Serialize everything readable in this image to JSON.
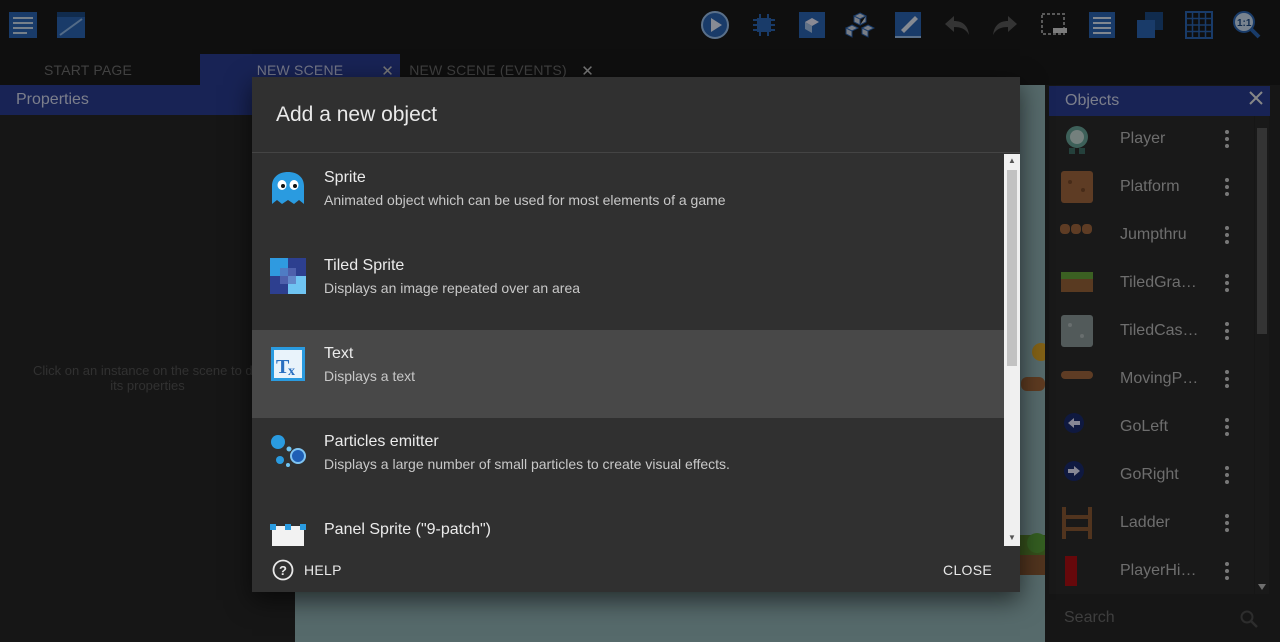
{
  "tabs": [
    {
      "label": "START PAGE"
    },
    {
      "label": "NEW SCENE"
    },
    {
      "label": "NEW SCENE (EVENTS)"
    }
  ],
  "properties": {
    "title": "Properties",
    "hint_line1": "Click on an instance on the scene to dis",
    "hint_line2": "its properties"
  },
  "objects_panel": {
    "title": "Objects",
    "items": [
      {
        "name": "Player",
        "icon": "player-icon"
      },
      {
        "name": "Platform",
        "icon": "platform-icon"
      },
      {
        "name": "Jumpthru",
        "icon": "jumpthru-icon"
      },
      {
        "name": "TiledGra…",
        "icon": "tiled-grass-icon"
      },
      {
        "name": "TiledCas…",
        "icon": "tiled-castle-icon"
      },
      {
        "name": "MovingP…",
        "icon": "moving-platform-icon"
      },
      {
        "name": "GoLeft",
        "icon": "go-left-icon"
      },
      {
        "name": "GoRight",
        "icon": "go-right-icon"
      },
      {
        "name": "Ladder",
        "icon": "ladder-icon"
      },
      {
        "name": "PlayerHi…",
        "icon": "player-hitbox-icon"
      }
    ],
    "search_placeholder": "Search"
  },
  "dialog": {
    "title": "Add a new object",
    "items": [
      {
        "name": "Sprite",
        "description": "Animated object which can be used for most elements of a game",
        "icon": "sprite-ghost-icon"
      },
      {
        "name": "Tiled Sprite",
        "description": "Displays an image repeated over an area",
        "icon": "tiled-sprite-icon"
      },
      {
        "name": "Text",
        "description": "Displays a text",
        "icon": "text-object-icon"
      },
      {
        "name": "Particles emitter",
        "description": "Displays a large number of small particles to create visual effects.",
        "icon": "particles-icon"
      },
      {
        "name": "Panel Sprite (\"9-patch\")",
        "description": "",
        "icon": "panel-sprite-icon"
      }
    ],
    "help_label": "HELP",
    "close_label": "CLOSE"
  },
  "colors": {
    "accent": "#2a3d93",
    "panel_bg": "#262626",
    "dialog_bg": "#303030",
    "scene_bg": "#95b7b9"
  }
}
